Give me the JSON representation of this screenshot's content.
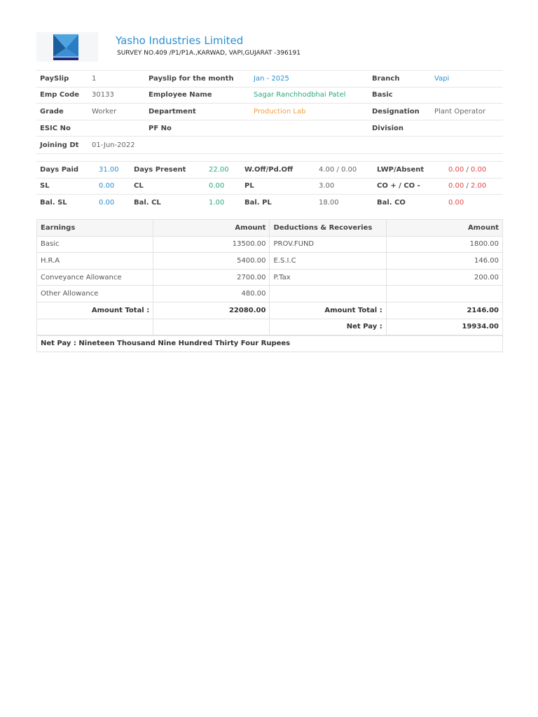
{
  "company": {
    "name": "Yasho Industries Limited",
    "address": "SURVEY NO.409 /P1/P1A.,KARWAD, VAPI,GUJARAT -396191",
    "logo_icon": "company-logo-icon",
    "logo_colors": {
      "light": "#4fa3de",
      "dark": "#1b5e9e",
      "bar": "#23287a"
    }
  },
  "info": {
    "payslip_label": "PaySlip",
    "payslip_value": "1",
    "month_label": "Payslip for the month",
    "month_value": "Jan - 2025",
    "branch_label": "Branch",
    "branch_value": "Vapi",
    "empcode_label": "Emp Code",
    "empcode_value": "30133",
    "empname_label": "Employee Name",
    "empname_value": "Sagar Ranchhodbhai Patel",
    "basic_label": "Basic",
    "basic_value": "",
    "grade_label": "Grade",
    "grade_value": "Worker",
    "department_label": "Department",
    "department_value": "Production Lab",
    "designation_label": "Designation",
    "designation_value": "Plant Operator",
    "esic_label": "ESIC No",
    "esic_value": "",
    "pf_label": "PF No",
    "pf_value": "",
    "division_label": "Division",
    "division_value": "",
    "joining_label": "Joining Dt",
    "joining_value": "01-Jun-2022"
  },
  "attendance": {
    "days_paid_label": "Days Paid",
    "days_paid": "31.00",
    "days_present_label": "Days Present",
    "days_present": "22.00",
    "woff_label": "W.Off/Pd.Off",
    "woff": "4.00 / 0.00",
    "lwp_label": "LWP/Absent",
    "lwp": "0.00",
    "absent": "0.00",
    "sl_label": "SL",
    "sl": "0.00",
    "cl_label": "CL",
    "cl": "0.00",
    "pl_label": "PL",
    "pl": "3.00",
    "co_label": "CO + / CO -",
    "co_plus": "0.00",
    "co_minus": "2.00",
    "bal_sl_label": "Bal. SL",
    "bal_sl": "0.00",
    "bal_cl_label": "Bal. CL",
    "bal_cl": "1.00",
    "bal_pl_label": "Bal. PL",
    "bal_pl": "18.00",
    "bal_co_label": "Bal. CO",
    "bal_co": "0.00",
    "separator": "/"
  },
  "pay": {
    "headers": {
      "earnings": "Earnings",
      "amount": "Amount",
      "deductions": "Deductions & Recoveries",
      "amount2": "Amount"
    },
    "rows": [
      {
        "earning": "Basic",
        "earning_amount": "13500.00",
        "deduction": "PROV.FUND",
        "deduction_amount": "1800.00"
      },
      {
        "earning": "H.R.A",
        "earning_amount": "5400.00",
        "deduction": "E.S.I.C",
        "deduction_amount": "146.00"
      },
      {
        "earning": "Conveyance Allowance",
        "earning_amount": "2700.00",
        "deduction": "P.Tax",
        "deduction_amount": "200.00"
      },
      {
        "earning": "Other Allowance",
        "earning_amount": "480.00",
        "deduction": "",
        "deduction_amount": ""
      }
    ],
    "total_label": "Amount Total :",
    "earnings_total": "22080.00",
    "deductions_total": "2146.00",
    "net_pay_label": "Net Pay :",
    "net_pay": "19934.00",
    "net_pay_words": "Net Pay : Nineteen Thousand Nine Hundred Thirty Four Rupees"
  }
}
